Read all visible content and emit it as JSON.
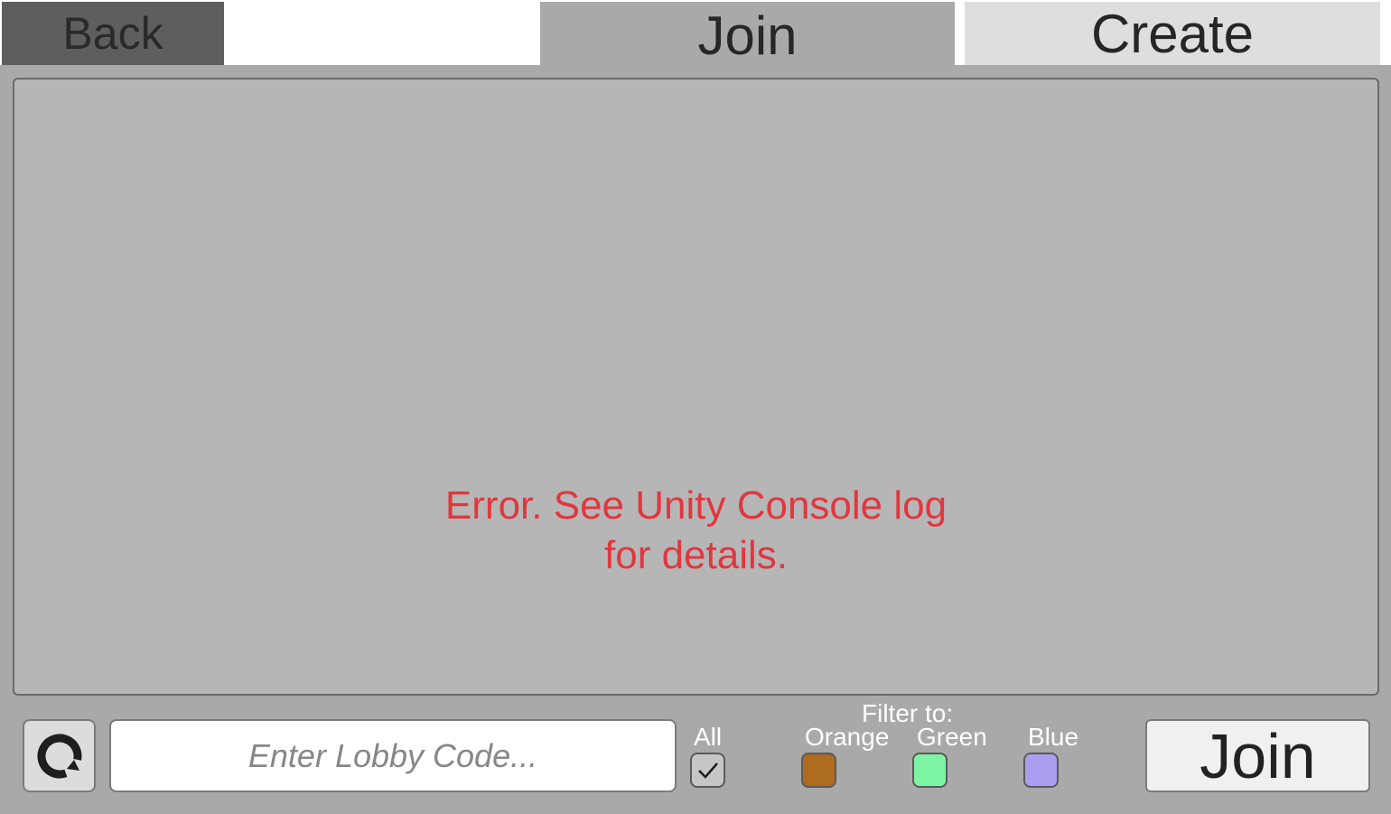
{
  "tabs": {
    "back_label": "Back",
    "join_label": "Join",
    "create_label": "Create"
  },
  "lobby_list": {
    "error_line1": "Error. See Unity Console log",
    "error_line2": "for details."
  },
  "bottom_bar": {
    "refresh_icon": "refresh-icon",
    "lobby_code_placeholder": "Enter Lobby Code...",
    "lobby_code_value": "",
    "filter_title": "Filter to:",
    "all_label": "All",
    "all_checked": true,
    "filters": [
      {
        "label": "Orange",
        "color": "#ad6c1f"
      },
      {
        "label": "Green",
        "color": "#7ef5a2"
      },
      {
        "label": "Blue",
        "color": "#aa9ef0"
      }
    ],
    "join_label": "Join"
  },
  "colors": {
    "error": "#e0373f",
    "panel_bg": "#a9a9a9",
    "list_bg": "#b6b6b6"
  }
}
